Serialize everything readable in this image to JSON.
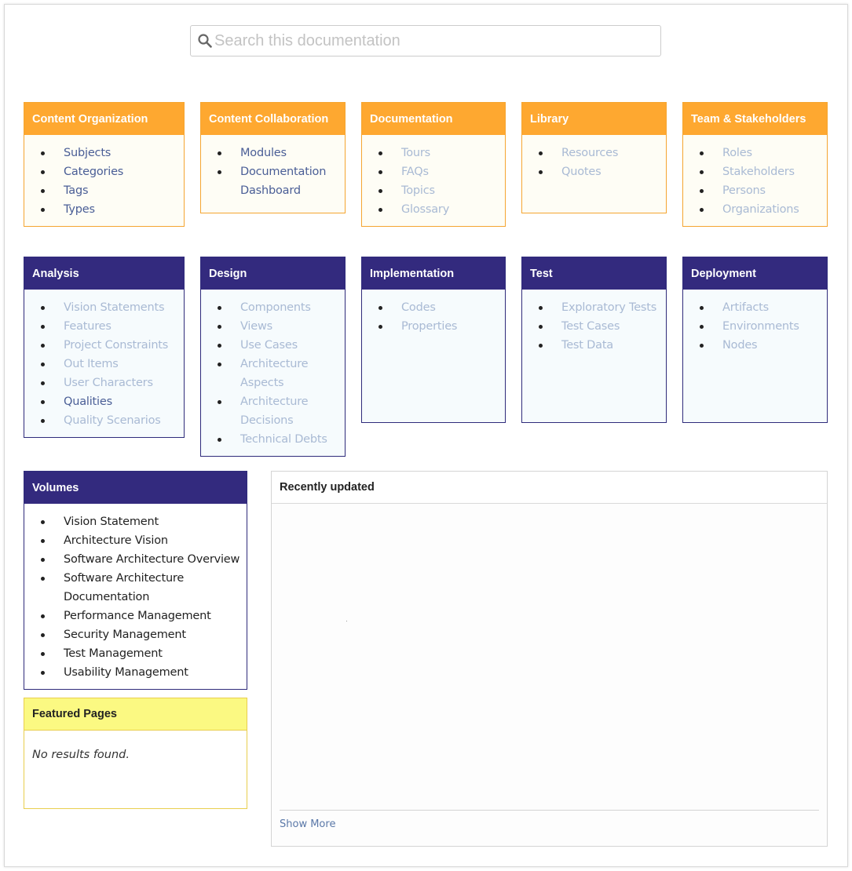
{
  "search": {
    "placeholder": "Search this documentation",
    "icon": "search-icon"
  },
  "colors": {
    "orange": "#fea830",
    "navy": "#332a7e",
    "yellow": "#fbf982",
    "link": "#4a5e96",
    "dim": "#a9bad4"
  },
  "row1": [
    {
      "title": "Content Organization",
      "items": [
        {
          "label": "Subjects",
          "state": "link"
        },
        {
          "label": "Categories",
          "state": "link"
        },
        {
          "label": "Tags",
          "state": "link"
        },
        {
          "label": "Types",
          "state": "link"
        }
      ]
    },
    {
      "title": "Content Collaboration",
      "items": [
        {
          "label": "Modules",
          "state": "link"
        },
        {
          "label": "Documentation Dashboard",
          "state": "link"
        }
      ]
    },
    {
      "title": "Documentation",
      "items": [
        {
          "label": "Tours",
          "state": "dim"
        },
        {
          "label": "FAQs",
          "state": "dim"
        },
        {
          "label": "Topics",
          "state": "dim"
        },
        {
          "label": "Glossary",
          "state": "dim"
        }
      ]
    },
    {
      "title": "Library",
      "items": [
        {
          "label": "Resources",
          "state": "dim"
        },
        {
          "label": "Quotes",
          "state": "dim"
        }
      ]
    },
    {
      "title": "Team & Stakeholders",
      "items": [
        {
          "label": "Roles",
          "state": "dim"
        },
        {
          "label": "Stakeholders",
          "state": "dim"
        },
        {
          "label": "Persons",
          "state": "dim"
        },
        {
          "label": "Organizations",
          "state": "dim"
        }
      ]
    }
  ],
  "row2": [
    {
      "title": "Analysis",
      "items": [
        {
          "label": "Vision Statements",
          "state": "dim"
        },
        {
          "label": "Features",
          "state": "dim"
        },
        {
          "label": "Project Constraints",
          "state": "dim"
        },
        {
          "label": "Out Items",
          "state": "dim"
        },
        {
          "label": "User Characters",
          "state": "dim"
        },
        {
          "label": "Qualities",
          "state": "link"
        },
        {
          "label": "Quality Scenarios",
          "state": "dim"
        }
      ]
    },
    {
      "title": "Design",
      "items": [
        {
          "label": "Components",
          "state": "dim"
        },
        {
          "label": "Views",
          "state": "dim"
        },
        {
          "label": "Use Cases",
          "state": "dim"
        },
        {
          "label": "Architecture Aspects",
          "state": "dim"
        },
        {
          "label": "Architecture Decisions",
          "state": "dim"
        },
        {
          "label": "Technical Debts",
          "state": "dim"
        }
      ]
    },
    {
      "title": "Implementation",
      "items": [
        {
          "label": "Codes",
          "state": "dim"
        },
        {
          "label": "Properties",
          "state": "dim"
        }
      ]
    },
    {
      "title": "Test",
      "items": [
        {
          "label": "Exploratory Tests",
          "state": "dim"
        },
        {
          "label": "Test Cases",
          "state": "dim"
        },
        {
          "label": "Test Data",
          "state": "dim"
        }
      ]
    },
    {
      "title": "Deployment",
      "items": [
        {
          "label": "Artifacts",
          "state": "dim"
        },
        {
          "label": "Environments",
          "state": "dim"
        },
        {
          "label": "Nodes",
          "state": "dim"
        }
      ]
    }
  ],
  "volumes": {
    "title": "Volumes",
    "items": [
      "Vision Statement",
      "Architecture Vision",
      "Software Architecture Overview",
      "Software Architecture Documentation",
      "Performance Management",
      "Security Management",
      "Test Management",
      "Usability Management"
    ]
  },
  "featured": {
    "title": "Featured Pages",
    "empty_text": "No results found."
  },
  "recent": {
    "title": "Recently updated",
    "show_more": "Show More"
  }
}
